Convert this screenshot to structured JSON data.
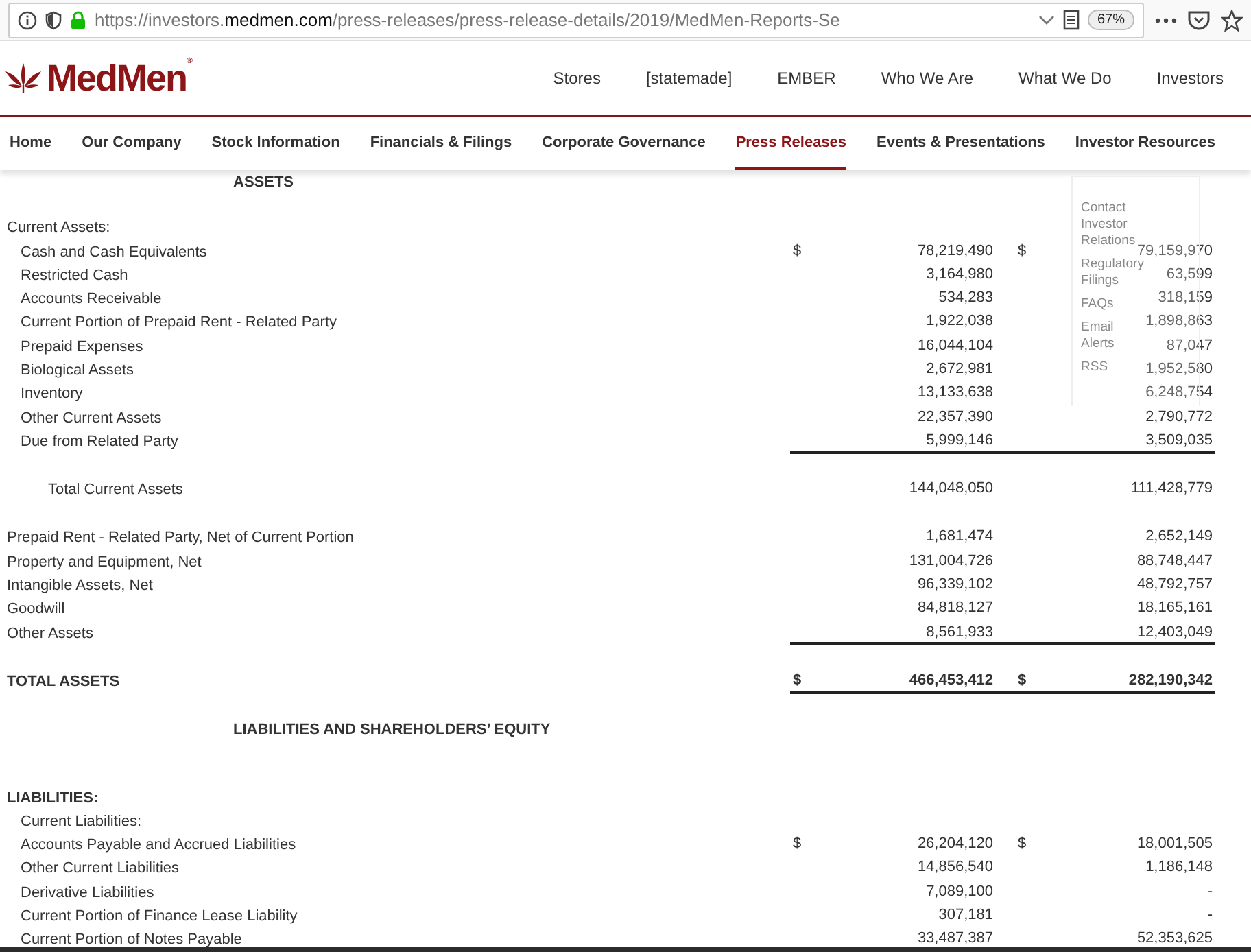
{
  "browser": {
    "url_start": "https://investors.",
    "url_domain": "medmen.com",
    "url_rest": "/press-releases/press-release-details/2019/MedMen-Reports-Se",
    "zoom": "67%"
  },
  "header": {
    "logo": "MedMen",
    "logo_mark": "®",
    "nav": [
      "Stores",
      "[statemade]",
      "EMBER",
      "Who We Are",
      "What We Do",
      "Investors"
    ]
  },
  "subnav": [
    {
      "label": "Home",
      "selected": false
    },
    {
      "label": "Our Company",
      "selected": false
    },
    {
      "label": "Stock Information",
      "selected": false
    },
    {
      "label": "Financials & Filings",
      "selected": false
    },
    {
      "label": "Corporate Governance",
      "selected": false
    },
    {
      "label": "Press Releases",
      "selected": true
    },
    {
      "label": "Events & Presentations",
      "selected": false
    },
    {
      "label": "Investor Resources",
      "selected": false
    }
  ],
  "dropdown": [
    "Contact Investor Relations",
    "Regulatory Filings",
    "FAQs",
    "Email Alerts",
    "RSS"
  ],
  "statement": {
    "rows": [
      {
        "kind": "heading",
        "label": "ASSETS"
      },
      {
        "kind": "group",
        "label": "Current Assets:"
      },
      {
        "kind": "item",
        "label": "Cash and Cash Equivalents",
        "dollar_1": "$",
        "value_1": "78,219,490",
        "dollar_2": "$",
        "value_2": "79,159,970"
      },
      {
        "kind": "item",
        "label": "Restricted Cash",
        "value_1": "3,164,980",
        "value_2": "63,599"
      },
      {
        "kind": "item",
        "label": "Accounts Receivable",
        "value_1": "534,283",
        "value_2": "318,159"
      },
      {
        "kind": "item",
        "label": "Current Portion of Prepaid Rent - Related Party",
        "value_1": "1,922,038",
        "value_2": "1,898,863"
      },
      {
        "kind": "item",
        "label": "Prepaid Expenses",
        "value_1": "16,044,104",
        "value_2": "87,047"
      },
      {
        "kind": "item",
        "label": "Biological Assets",
        "value_1": "2,672,981",
        "value_2": "1,952,580"
      },
      {
        "kind": "item",
        "label": "Inventory",
        "value_1": "13,133,638",
        "value_2": "6,248,754"
      },
      {
        "kind": "item",
        "label": "Other Current Assets",
        "value_1": "22,357,390",
        "value_2": "2,790,772"
      },
      {
        "kind": "item",
        "label": "Due from Related Party",
        "value_1": "5,999,146",
        "value_2": "3,509,035",
        "underline": true
      },
      {
        "kind": "total",
        "label": "Total Current Assets",
        "value_1": "144,048,050",
        "value_2": "111,428,779"
      },
      {
        "kind": "group",
        "label": "Prepaid Rent - Related Party, Net of Current Portion",
        "value_1": "1,681,474",
        "value_2": "2,652,149"
      },
      {
        "kind": "group",
        "label": "Property and Equipment, Net",
        "value_1": "131,004,726",
        "value_2": "88,748,447"
      },
      {
        "kind": "group",
        "label": "Intangible Assets, Net",
        "value_1": "96,339,102",
        "value_2": "48,792,757"
      },
      {
        "kind": "group",
        "label": "Goodwill",
        "value_1": "84,818,127",
        "value_2": "18,165,161"
      },
      {
        "kind": "group",
        "label": "Other Assets",
        "value_1": "8,561,933",
        "value_2": "12,403,049",
        "underline": true
      },
      {
        "kind": "grand",
        "label": "TOTAL ASSETS",
        "dollar_1": "$",
        "value_1": "466,453,412",
        "dollar_2": "$",
        "value_2": "282,190,342",
        "underline": true
      },
      {
        "kind": "heading",
        "label": "LIABILITIES AND SHAREHOLDERS’ EQUITY"
      },
      {
        "kind": "section",
        "label": "LIABILITIES:"
      },
      {
        "kind": "subgroup",
        "label": "Current Liabilities:"
      },
      {
        "kind": "item",
        "label": "Accounts Payable and Accrued Liabilities",
        "dollar_1": "$",
        "value_1": "26,204,120",
        "dollar_2": "$",
        "value_2": "18,001,505"
      },
      {
        "kind": "item",
        "label": "Other Current Liabilities",
        "value_1": "14,856,540",
        "value_2": "1,186,148"
      },
      {
        "kind": "item",
        "label": "Derivative Liabilities",
        "value_1": "7,089,100",
        "value_2": "-"
      },
      {
        "kind": "item",
        "label": "Current Portion of Finance Lease Liability",
        "value_1": "307,181",
        "value_2": "-"
      },
      {
        "kind": "item",
        "label": "Current Portion of Notes Payable",
        "value_1": "33,487,387",
        "value_2": "52,353,625"
      }
    ]
  }
}
